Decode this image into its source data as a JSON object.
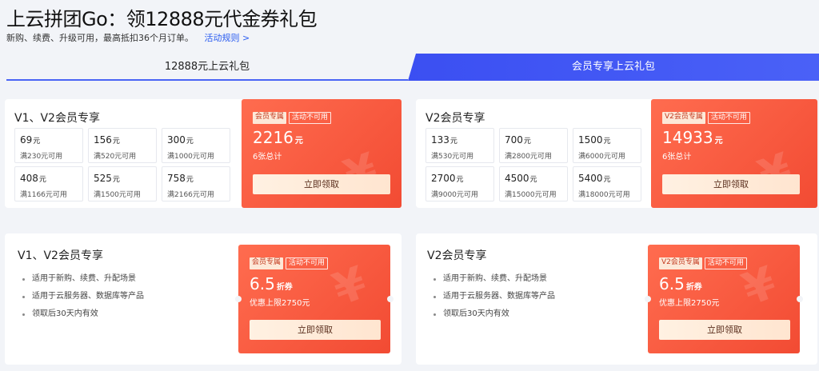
{
  "header": {
    "title": "上云拼团Go：领12888元代金券礼包",
    "subtitle": "新购、续费、升级可用，最高抵扣36个月订单。",
    "rule_link": "活动规则 >"
  },
  "tabs": [
    {
      "label": "12888元上云礼包",
      "active": false
    },
    {
      "label": "会员专享上云礼包",
      "active": true
    }
  ],
  "voucher_cards": [
    {
      "heading": "V1、V2会员专享",
      "coupons": [
        {
          "amount": "69",
          "unit": "元",
          "condition": "满230元可用"
        },
        {
          "amount": "156",
          "unit": "元",
          "condition": "满520元可用"
        },
        {
          "amount": "300",
          "unit": "元",
          "condition": "满1000元可用"
        },
        {
          "amount": "408",
          "unit": "元",
          "condition": "满1166元可用"
        },
        {
          "amount": "525",
          "unit": "元",
          "condition": "满1500元可用"
        },
        {
          "amount": "758",
          "unit": "元",
          "condition": "满2166元可用"
        }
      ],
      "promo": {
        "tag_fill": "会员专属",
        "tag_line": "活动不可用",
        "total": "2216",
        "total_unit": "元",
        "note": "6张总计",
        "claim": "立即领取"
      }
    },
    {
      "heading": "V2会员专享",
      "coupons": [
        {
          "amount": "133",
          "unit": "元",
          "condition": "满530元可用"
        },
        {
          "amount": "700",
          "unit": "元",
          "condition": "满2800元可用"
        },
        {
          "amount": "1500",
          "unit": "元",
          "condition": "满6000元可用"
        },
        {
          "amount": "2700",
          "unit": "元",
          "condition": "满9000元可用"
        },
        {
          "amount": "4500",
          "unit": "元",
          "condition": "满15000元可用"
        },
        {
          "amount": "5400",
          "unit": "元",
          "condition": "满18000元可用"
        }
      ],
      "promo": {
        "tag_fill": "V2会员专属",
        "tag_line": "活动不可用",
        "total": "14933",
        "total_unit": "元",
        "note": "6张总计",
        "claim": "立即领取"
      }
    }
  ],
  "discount_cards": [
    {
      "heading": "V1、V2会员专享",
      "bullets": [
        "适用于新购、续费、升配场景",
        "适用于云服务器、数据库等产品",
        "领取后30天内有效"
      ],
      "promo": {
        "tag_fill": "会员专属",
        "tag_line": "活动不可用",
        "discount": "6.5",
        "discount_unit": "折券",
        "note": "优惠上限2750元",
        "claim": "立即领取"
      }
    },
    {
      "heading": "V2会员专享",
      "bullets": [
        "适用于新购、续费、升配场景",
        "适用于云服务器、数据库等产品",
        "领取后30天内有效"
      ],
      "promo": {
        "tag_fill": "V2会员专属",
        "tag_line": "活动不可用",
        "discount": "6.5",
        "discount_unit": "折券",
        "note": "优惠上限2750元",
        "claim": "立即领取"
      }
    }
  ],
  "colors": {
    "accent_blue": "#3b4ff2",
    "promo_red": "#f24b33",
    "claim_bg": "#fff1e2"
  },
  "icons": {
    "watermark": "yen-watermark-icon"
  }
}
